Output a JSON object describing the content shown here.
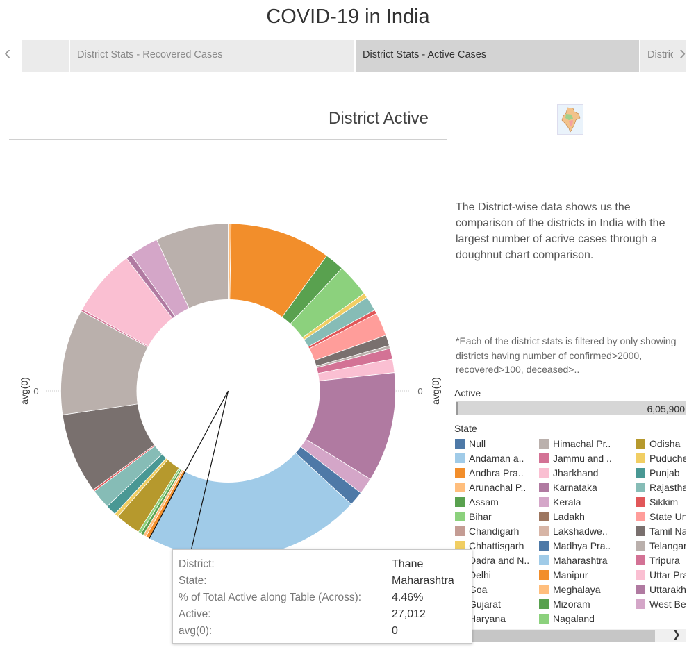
{
  "page": {
    "title": "COVID-19 in India"
  },
  "tabs": [
    {
      "label": ""
    },
    {
      "label": "District Stats - Recovered Cases"
    },
    {
      "label": "District Stats -  Active Cases"
    },
    {
      "label": "District Stats - Deceased Cases"
    }
  ],
  "description": "The District-wise data shows us the comparison of the districts in India with the largest number of acrive cases through a doughnut chart comparison.",
  "note": "*Each of the district stats is filtered by only showing districts having number of confirmed>2000, recovered>100, deceased>..",
  "active_filter": {
    "title": "Active",
    "value": "6,05,900"
  },
  "state_legend": {
    "title": "State",
    "items": [
      {
        "label": "Null",
        "color": "#4e79a7"
      },
      {
        "label": "Andaman a..",
        "color": "#a0cbe8"
      },
      {
        "label": "Andhra Pra..",
        "color": "#f28e2b"
      },
      {
        "label": "Arunachal P..",
        "color": "#ffbe7d"
      },
      {
        "label": "Assam",
        "color": "#59a14f"
      },
      {
        "label": "Bihar",
        "color": "#8cd17d"
      },
      {
        "label": "Chandigarh",
        "color": "#c49c94"
      },
      {
        "label": "Chhattisgarh",
        "color": "#f1ce63"
      },
      {
        "label": "Dadra and N..",
        "color": "#499894"
      },
      {
        "label": "Delhi",
        "color": "#86bcb6"
      },
      {
        "label": "Goa",
        "color": "#e15759"
      },
      {
        "label": "Gujarat",
        "color": "#ff9d9a"
      },
      {
        "label": "Haryana",
        "color": "#79706e"
      },
      {
        "label": "Himachal Pr..",
        "color": "#bab0ac"
      },
      {
        "label": "Jammu and ..",
        "color": "#d37295"
      },
      {
        "label": "Jharkhand",
        "color": "#fabfd2"
      },
      {
        "label": "Karnataka",
        "color": "#b07aa1"
      },
      {
        "label": "Kerala",
        "color": "#d4a6c8"
      },
      {
        "label": "Ladakh",
        "color": "#9d7660"
      },
      {
        "label": "Lakshadwe..",
        "color": "#d7b5a6"
      },
      {
        "label": "Madhya Pra..",
        "color": "#4e79a7"
      },
      {
        "label": "Maharashtra",
        "color": "#a0cbe8"
      },
      {
        "label": "Manipur",
        "color": "#f28e2b"
      },
      {
        "label": "Meghalaya",
        "color": "#ffbe7d"
      },
      {
        "label": "Mizoram",
        "color": "#59a14f"
      },
      {
        "label": "Nagaland",
        "color": "#8cd17d"
      },
      {
        "label": "Odisha",
        "color": "#b6992d"
      },
      {
        "label": "Puducherry",
        "color": "#f1ce63"
      },
      {
        "label": "Punjab",
        "color": "#499894"
      },
      {
        "label": "Rajasthan",
        "color": "#86bcb6"
      },
      {
        "label": "Sikkim",
        "color": "#e15759"
      },
      {
        "label": "State Unassigned",
        "color": "#ff9d9a"
      },
      {
        "label": "Tamil Nadu",
        "color": "#79706e"
      },
      {
        "label": "Telangana",
        "color": "#bab0ac"
      },
      {
        "label": "Tripura",
        "color": "#d37295"
      },
      {
        "label": "Uttar Pradesh",
        "color": "#fabfd2"
      },
      {
        "label": "Uttarakhand",
        "color": "#b07aa1"
      },
      {
        "label": "West Bengal",
        "color": "#d4a6c8"
      }
    ]
  },
  "tooltip": {
    "rows": [
      {
        "label": "District:",
        "value": "Thane"
      },
      {
        "label": "State:",
        "value": "Maharashtra"
      },
      {
        "label": "% of Total Active along Table (Across):",
        "value": "4.46%"
      },
      {
        "label": "Active:",
        "value": "27,012"
      },
      {
        "label": "avg(0):",
        "value": "0"
      }
    ]
  },
  "chart_data": {
    "type": "pie",
    "variant": "doughnut",
    "title": "District Active",
    "ylabel_left": "avg(0)",
    "ylabel_right": "avg(0)",
    "y_tick": "0",
    "total_active": 605900,
    "highlighted_slice": {
      "district": "Thane",
      "state": "Maharashtra",
      "share_pct": 4.46,
      "active": 27012
    },
    "slices_clockwise_from_top": [
      {
        "state": "Arunachal Pradesh",
        "share_pct": 0.3
      },
      {
        "state": "Andhra Pradesh",
        "share_pct": 10.4
      },
      {
        "state": "Assam",
        "share_pct": 2.0
      },
      {
        "state": "Bihar",
        "share_pct": 3.4
      },
      {
        "state": "Chhattisgarh",
        "share_pct": 0.5
      },
      {
        "state": "Delhi",
        "share_pct": 1.5
      },
      {
        "state": "Goa",
        "share_pct": 0.4
      },
      {
        "state": "Gujarat",
        "share_pct": 2.4
      },
      {
        "state": "Haryana",
        "share_pct": 1.1
      },
      {
        "state": "Himachal Pradesh",
        "share_pct": 0.3
      },
      {
        "state": "Jammu and Kashmir",
        "share_pct": 1.1
      },
      {
        "state": "Jharkhand",
        "share_pct": 1.4
      },
      {
        "state": "Karnataka",
        "share_pct": 11.3
      },
      {
        "state": "Kerala",
        "share_pct": 1.7
      },
      {
        "state": "Madhya Pradesh",
        "share_pct": 1.5
      },
      {
        "state": "Maharashtra",
        "share_pct": 17.9
      },
      {
        "state": "Maharashtra",
        "share_pct": 4.46
      },
      {
        "state": "Manipur",
        "share_pct": 0.4
      },
      {
        "state": "Meghalaya",
        "share_pct": 0.3
      },
      {
        "state": "Mizoram",
        "share_pct": 0.3
      },
      {
        "state": "Nagaland",
        "share_pct": 0.3
      },
      {
        "state": "Odisha",
        "share_pct": 2.6
      },
      {
        "state": "Puducherry",
        "share_pct": 0.4
      },
      {
        "state": "Punjab",
        "share_pct": 1.1
      },
      {
        "state": "Rajasthan",
        "share_pct": 2.0
      },
      {
        "state": "Sikkim",
        "share_pct": 0.2
      },
      {
        "state": "Tamil Nadu",
        "share_pct": 8.3
      },
      {
        "state": "Telangana",
        "share_pct": 10.9
      },
      {
        "state": "Tripura",
        "share_pct": 0.2
      },
      {
        "state": "Uttar Pradesh",
        "share_pct": 6.9
      },
      {
        "state": "Uttarakhand",
        "share_pct": 0.6
      },
      {
        "state": "West Bengal",
        "share_pct": 3.0
      },
      {
        "state": "Himachal Pradesh",
        "share_pct": 7.5
      }
    ],
    "state_colors": {
      "Arunachal Pradesh": "#ffbe7d",
      "Andhra Pradesh": "#f28e2b",
      "Assam": "#59a14f",
      "Bihar": "#8cd17d",
      "Chhattisgarh": "#f1ce63",
      "Delhi": "#86bcb6",
      "Goa": "#e15759",
      "Gujarat": "#ff9d9a",
      "Haryana": "#79706e",
      "Himachal Pradesh": "#bab0ac",
      "Jammu and Kashmir": "#d37295",
      "Jharkhand": "#fabfd2",
      "Karnataka": "#b07aa1",
      "Kerala": "#d4a6c8",
      "Madhya Pradesh": "#4e79a7",
      "Maharashtra": "#a0cbe8",
      "Manipur": "#f28e2b",
      "Meghalaya": "#ffbe7d",
      "Mizoram": "#59a14f",
      "Nagaland": "#8cd17d",
      "Odisha": "#b6992d",
      "Puducherry": "#f1ce63",
      "Punjab": "#499894",
      "Rajasthan": "#86bcb6",
      "Sikkim": "#e15759",
      "Tamil Nadu": "#79706e",
      "Telangana": "#bab0ac",
      "Tripura": "#d37295",
      "Uttar Pradesh": "#fabfd2",
      "Uttarakhand": "#b07aa1",
      "West Bengal": "#d4a6c8"
    }
  }
}
